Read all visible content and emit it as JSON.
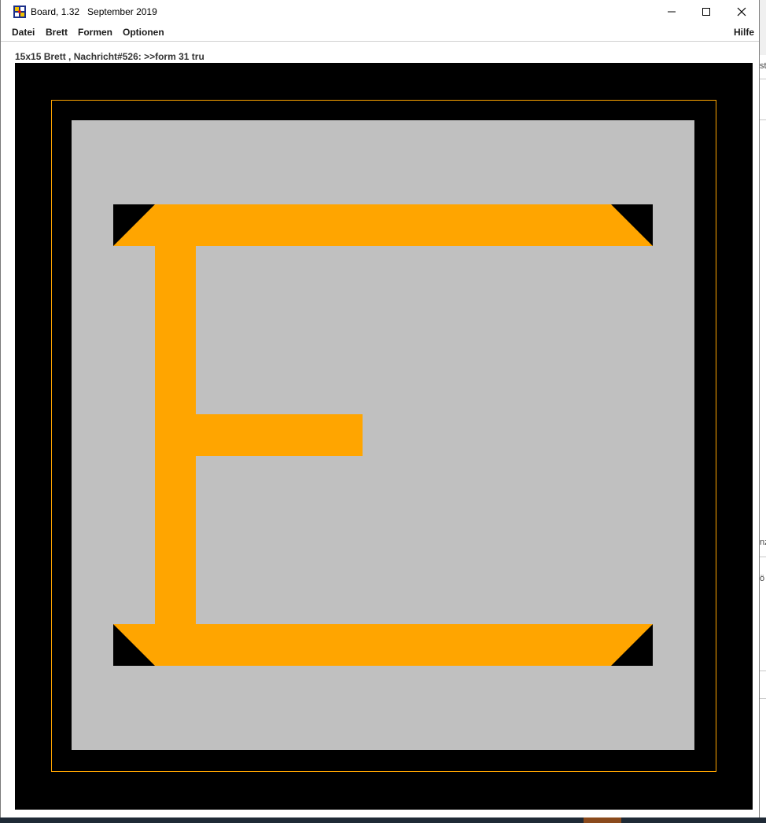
{
  "window": {
    "title": "Board, 1.32   September 2019",
    "icon": "board-app-icon"
  },
  "controls": {
    "minimize_icon": "minimize-icon",
    "maximize_icon": "maximize-icon",
    "close_icon": "close-icon"
  },
  "menu": {
    "items": [
      {
        "label": "Datei"
      },
      {
        "label": "Brett"
      },
      {
        "label": "Formen"
      },
      {
        "label": "Optionen"
      }
    ],
    "help_label": "Hilfe"
  },
  "status": {
    "text": "15x15 Brett , Nachricht#526: >>form 31 tru"
  },
  "board": {
    "size": "15x15",
    "background_color": "#000000",
    "field_color": "#c0c0c0",
    "shape_color": "#ffa500",
    "border_line_color": "#ffa500"
  },
  "side_strip": {
    "chars": [
      "st",
      "nz",
      "ö"
    ]
  }
}
